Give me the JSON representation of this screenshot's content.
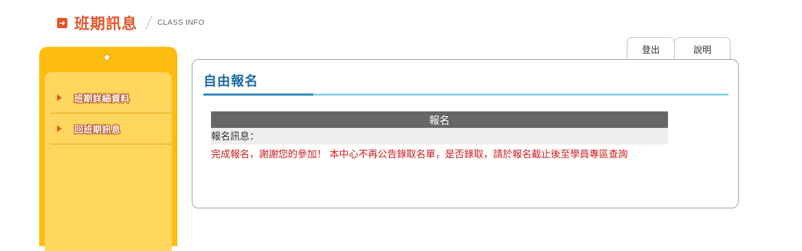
{
  "header": {
    "title": "班期訊息",
    "subtitle": "CLASS INFO",
    "icon": "arrow-right-box-icon",
    "accent_color": "#e0582a"
  },
  "sidebar": {
    "bg_color": "#fdbd10",
    "panel_color": "#ffd65e",
    "items": [
      {
        "label": "班期詳細資料",
        "icon": "triangle-right-icon"
      },
      {
        "label": "回班期訊息",
        "icon": "triangle-right-icon"
      }
    ]
  },
  "tabs": {
    "logout": "登出",
    "help": "說明"
  },
  "main": {
    "title": "自由報名",
    "title_color": "#1a6aa6",
    "section_header": "報名",
    "info_label": "報名訊息：",
    "message": "完成報名，謝謝您的參加！ 本中心不再公告錄取名單，是否錄取，請於報名截止後至學員專區查詢",
    "message_color": "#d11a1a"
  }
}
